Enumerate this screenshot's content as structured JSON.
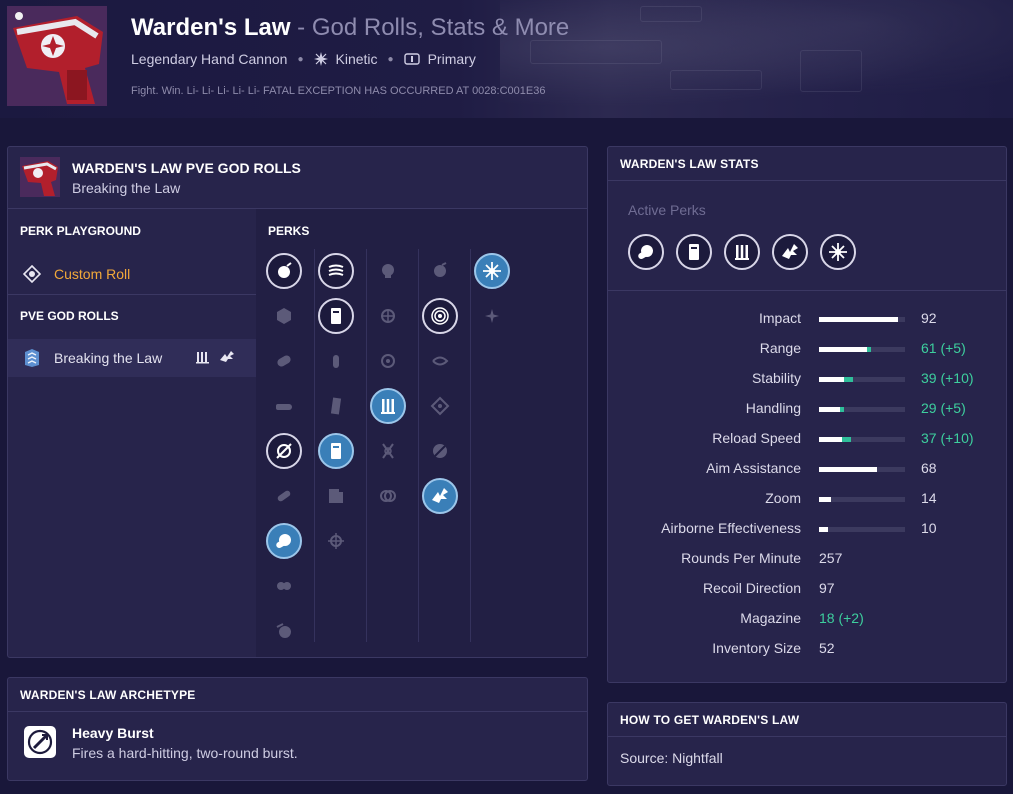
{
  "header": {
    "weapon_name": "Warden's Law",
    "subtitle": " - God Rolls, Stats & More",
    "type": "Legendary Hand Cannon",
    "element": "Kinetic",
    "slot": "Primary",
    "flavor": "Fight. Win. Li- Li- Li- Li- Li- FATAL EXCEPTION HAS OCCURRED AT 0028:C001E36"
  },
  "god_rolls": {
    "title": "WARDEN'S LAW PVE GOD ROLLS",
    "subtitle": "Breaking the Law",
    "perk_playground_label": "PERK PLAYGROUND",
    "custom_roll_label": "Custom Roll",
    "pve_god_rolls_label": "PVE GOD ROLLS",
    "selected_roll_label": "Breaking the Law",
    "perks_label": "PERKS",
    "perk_columns": [
      {
        "perks": [
          {
            "icon": "grenade-icon",
            "state": "selected"
          },
          {
            "icon": "cube-icon",
            "state": "dim"
          },
          {
            "icon": "capsule-icon",
            "state": "dim"
          },
          {
            "icon": "barrel-icon",
            "state": "dim"
          },
          {
            "icon": "crossed-barrel-icon",
            "state": "selected"
          },
          {
            "icon": "slanted-barrel-icon",
            "state": "dim"
          },
          {
            "icon": "round-barrel-icon",
            "state": "selected-blue"
          },
          {
            "icon": "twin-barrel-icon",
            "state": "dim"
          },
          {
            "icon": "fin-barrel-icon",
            "state": "dim"
          }
        ]
      },
      {
        "perks": [
          {
            "icon": "wavy-lines-icon",
            "state": "selected"
          },
          {
            "icon": "magazine-icon",
            "state": "selected"
          },
          {
            "icon": "bullet-icon",
            "state": "dim"
          },
          {
            "icon": "tall-magazine-icon",
            "state": "dim"
          },
          {
            "icon": "magazine-blue-icon",
            "state": "selected-blue"
          },
          {
            "icon": "stacked-magazine-icon",
            "state": "dim"
          },
          {
            "icon": "crosshair-mag-icon",
            "state": "dim"
          }
        ]
      },
      {
        "perks": [
          {
            "icon": "skull-icon",
            "state": "dim"
          },
          {
            "icon": "compass-icon",
            "state": "dim"
          },
          {
            "icon": "target-icon",
            "state": "dim"
          },
          {
            "icon": "bars-icon",
            "state": "selected-blue"
          },
          {
            "icon": "hourglass-icon",
            "state": "dim"
          },
          {
            "icon": "rings-icon",
            "state": "dim"
          }
        ]
      },
      {
        "perks": [
          {
            "icon": "burst-icon",
            "state": "dim"
          },
          {
            "icon": "bullseye-icon",
            "state": "selected"
          },
          {
            "icon": "swirl-icon",
            "state": "dim"
          },
          {
            "icon": "diamond-icon",
            "state": "dim"
          },
          {
            "icon": "leaf-icon",
            "state": "dim"
          },
          {
            "icon": "dragon-icon",
            "state": "selected-blue"
          }
        ]
      },
      {
        "perks": [
          {
            "icon": "starburst-icon",
            "state": "selected-blue"
          },
          {
            "icon": "sparkle-icon",
            "state": "dim"
          }
        ]
      }
    ]
  },
  "archetype": {
    "title": "WARDEN'S LAW ARCHETYPE",
    "name": "Heavy Burst",
    "description": "Fires a hard-hitting, two-round burst."
  },
  "stats": {
    "title": "WARDEN'S LAW STATS",
    "active_perks_label": "Active Perks",
    "active_perk_icons": [
      "round-barrel-icon",
      "magazine-icon",
      "bars-icon",
      "dragon-icon",
      "starburst-icon"
    ],
    "rows": [
      {
        "name": "Impact",
        "value": "92",
        "base": 92,
        "bonus": 0,
        "bar": true
      },
      {
        "name": "Range",
        "value": "61 (+5)",
        "base": 56,
        "bonus": 5,
        "bar": true
      },
      {
        "name": "Stability",
        "value": "39 (+10)",
        "base": 29,
        "bonus": 10,
        "bar": true
      },
      {
        "name": "Handling",
        "value": "29 (+5)",
        "base": 24,
        "bonus": 5,
        "bar": true
      },
      {
        "name": "Reload Speed",
        "value": "37 (+10)",
        "base": 27,
        "bonus": 10,
        "bar": true
      },
      {
        "name": "Aim Assistance",
        "value": "68",
        "base": 68,
        "bonus": 0,
        "bar": true
      },
      {
        "name": "Zoom",
        "value": "14",
        "base": 14,
        "bonus": 0,
        "bar": true
      },
      {
        "name": "Airborne Effectiveness",
        "value": "10",
        "base": 10,
        "bonus": 0,
        "bar": true
      },
      {
        "name": "Rounds Per Minute",
        "value": "257",
        "bar": false
      },
      {
        "name": "Recoil Direction",
        "value": "97",
        "bar": false
      },
      {
        "name": "Magazine",
        "value": "18 (+2)",
        "bar": false,
        "green": true
      },
      {
        "name": "Inventory Size",
        "value": "52",
        "bar": false
      }
    ]
  },
  "how_to_get": {
    "title": "HOW TO GET WARDEN'S LAW",
    "source": "Source: Nightfall"
  },
  "colors": {
    "background": "#19173a",
    "panel": "#27244b",
    "accent_blue": "#3a7fb8",
    "bonus_green": "#3dcf9e",
    "custom_roll_orange": "#f2a93a"
  }
}
